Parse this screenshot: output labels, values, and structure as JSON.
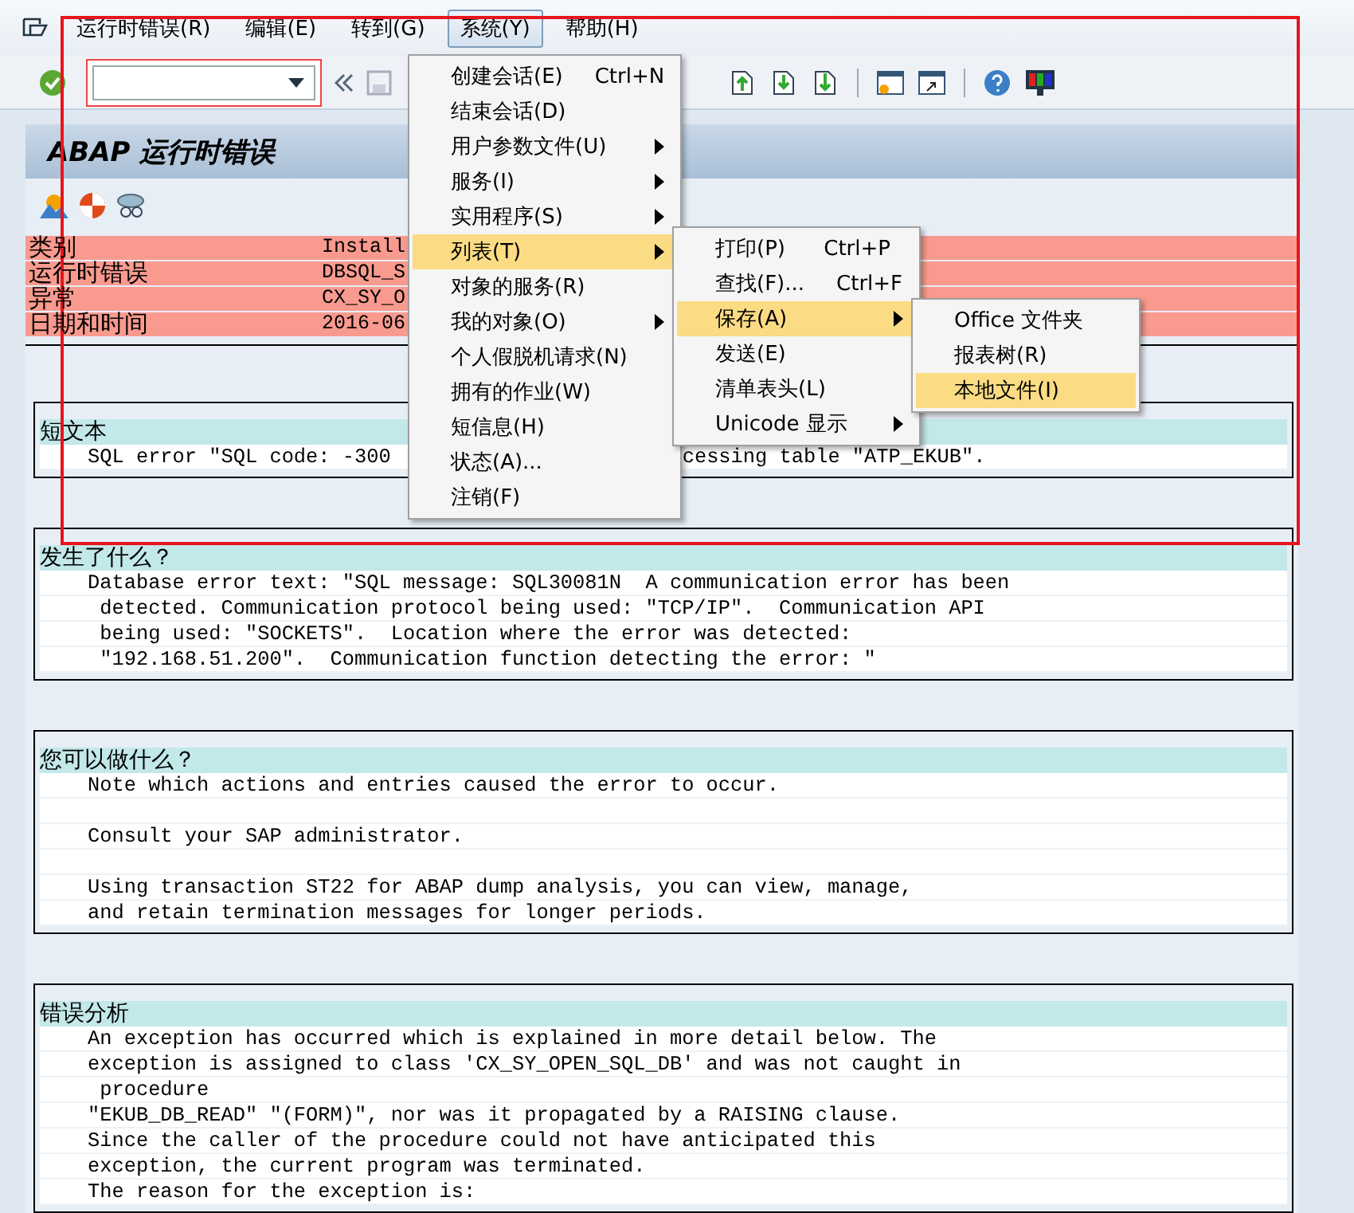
{
  "menubar": {
    "items": [
      {
        "label": "运行时错误(R)",
        "selected": false
      },
      {
        "label": "编辑(E)",
        "selected": false
      },
      {
        "label": "转到(G)",
        "selected": false
      },
      {
        "label": "系统(Y)",
        "selected": true
      },
      {
        "label": "帮助(H)",
        "selected": false
      }
    ]
  },
  "title": "ABAP 运行时错误",
  "info_rows": [
    {
      "label": "类别",
      "value": "Install"
    },
    {
      "label": "运行时错误",
      "value": "DBSQL_S"
    },
    {
      "label": "异常",
      "value": "CX_SY_O"
    },
    {
      "label": "日期和时间",
      "value": "2016-06"
    }
  ],
  "sections": [
    {
      "heading": "短文本",
      "lines": [
        {
          "text": "SQL error \"SQL code: -300",
          "text_right": "cessing table \"ATP_EKUB\"."
        }
      ]
    },
    {
      "heading": "发生了什么？",
      "lines": [
        {
          "text": "Database error text: \"SQL message: SQL30081N  A communication error has been"
        },
        {
          "text": " detected. Communication protocol being used: \"TCP/IP\".  Communication API"
        },
        {
          "text": " being used: \"SOCKETS\".  Location where the error was detected:"
        },
        {
          "text": " \"192.168.51.200\".  Communication function detecting the error: \""
        }
      ]
    },
    {
      "heading": "您可以做什么？",
      "lines": [
        {
          "text": "Note which actions and entries caused the error to occur."
        },
        {
          "kind": "blank"
        },
        {
          "text": "Consult your SAP administrator."
        },
        {
          "kind": "blank"
        },
        {
          "text": "Using transaction ST22 for ABAP dump analysis, you can view, manage,"
        },
        {
          "text": "and retain termination messages for longer periods."
        }
      ]
    },
    {
      "heading": "错误分析",
      "lines": [
        {
          "text": "An exception has occurred which is explained in more detail below. The"
        },
        {
          "text": "exception is assigned to class 'CX_SY_OPEN_SQL_DB' and was not caught in"
        },
        {
          "text": " procedure"
        },
        {
          "text": "\"EKUB_DB_READ\" \"(FORM)\", nor was it propagated by a RAISING clause."
        },
        {
          "text": "Since the caller of the procedure could not have anticipated this"
        },
        {
          "text": "exception, the current program was terminated."
        },
        {
          "text": "The reason for the exception is:"
        }
      ]
    }
  ],
  "system_menu": {
    "items": [
      {
        "label": "创建会话(E)",
        "shortcut": "Ctrl+N",
        "has_submenu": false,
        "selected": false
      },
      {
        "label": "结束会话(D)",
        "has_submenu": false,
        "selected": false
      },
      {
        "label": "用户参数文件(U)",
        "has_submenu": true,
        "selected": false
      },
      {
        "label": "服务(I)",
        "has_submenu": true,
        "selected": false
      },
      {
        "label": "实用程序(S)",
        "has_submenu": true,
        "selected": false
      },
      {
        "label": "列表(T)",
        "has_submenu": true,
        "selected": true
      },
      {
        "label": "对象的服务(R)",
        "has_submenu": false,
        "selected": false
      },
      {
        "label": "我的对象(O)",
        "has_submenu": true,
        "selected": false
      },
      {
        "label": "个人假脱机请求(N)",
        "has_submenu": false,
        "selected": false
      },
      {
        "label": "拥有的作业(W)",
        "has_submenu": false,
        "selected": false
      },
      {
        "label": "短信息(H)",
        "has_submenu": false,
        "selected": false
      },
      {
        "label": "状态(A)...",
        "has_submenu": false,
        "selected": false
      },
      {
        "label": "注销(F)",
        "has_submenu": false,
        "selected": false
      }
    ]
  },
  "list_submenu": {
    "items": [
      {
        "label": "打印(P)",
        "shortcut": "Ctrl+P",
        "has_submenu": false,
        "selected": false
      },
      {
        "label": "查找(F)...",
        "shortcut": "Ctrl+F",
        "has_submenu": false,
        "selected": false
      },
      {
        "label": "保存(A)",
        "has_submenu": true,
        "selected": true
      },
      {
        "label": "发送(E)",
        "has_submenu": false,
        "selected": false
      },
      {
        "label": "清单表头(L)",
        "has_submenu": false,
        "selected": false
      },
      {
        "label": "Unicode 显示",
        "has_submenu": true,
        "selected": false
      }
    ]
  },
  "save_submenu": {
    "items": [
      {
        "label": "Office 文件夹",
        "has_submenu": false,
        "selected": false
      },
      {
        "label": "报表树(R)",
        "has_submenu": false,
        "selected": false
      },
      {
        "label": "本地文件(I)",
        "has_submenu": false,
        "selected": true
      }
    ]
  }
}
